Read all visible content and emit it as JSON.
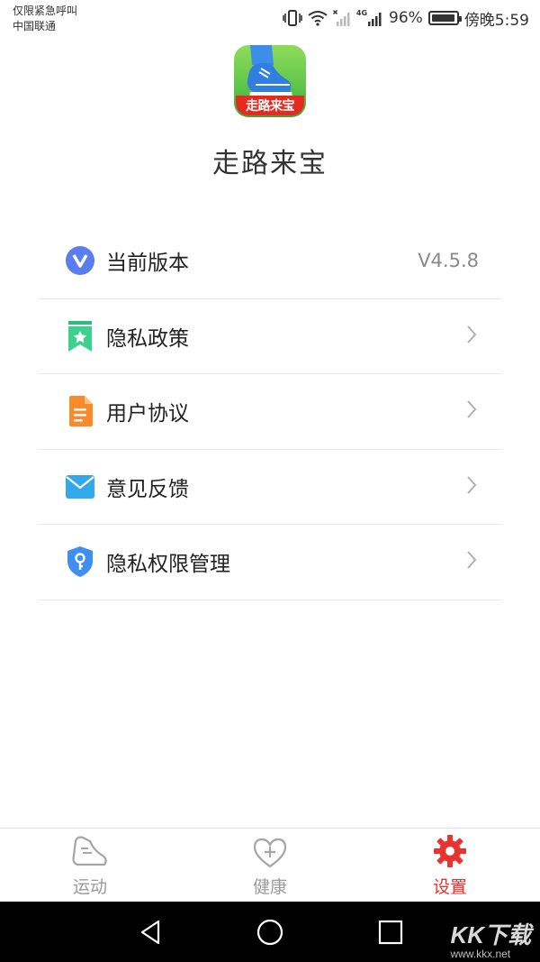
{
  "status_bar": {
    "emergency_text": "仅限紧急呼叫",
    "carrier": "中国联通",
    "network": "4G",
    "battery": "96%",
    "battery_level": 0.96,
    "time": "傍晚5:59"
  },
  "app": {
    "logo_text": "走路来宝",
    "name": "走路来宝"
  },
  "menu": {
    "items": [
      {
        "label": "当前版本",
        "value": "V4.5.8",
        "icon": "v-badge-icon"
      },
      {
        "label": "隐私政策",
        "icon": "bookmark-star-icon"
      },
      {
        "label": "用户协议",
        "icon": "document-icon"
      },
      {
        "label": "意见反馈",
        "icon": "envelope-icon"
      },
      {
        "label": "隐私权限管理",
        "icon": "shield-key-icon"
      }
    ]
  },
  "tabs": [
    {
      "label": "运动",
      "icon": "sneaker-icon",
      "active": false
    },
    {
      "label": "健康",
      "icon": "heart-plus-icon",
      "active": false
    },
    {
      "label": "设置",
      "icon": "gear-icon",
      "active": true
    }
  ],
  "colors": {
    "accent": "#e8332f",
    "inactive": "#9a9a9a"
  },
  "watermark": {
    "logo": "KK下载",
    "url": "www.kkx.net"
  }
}
